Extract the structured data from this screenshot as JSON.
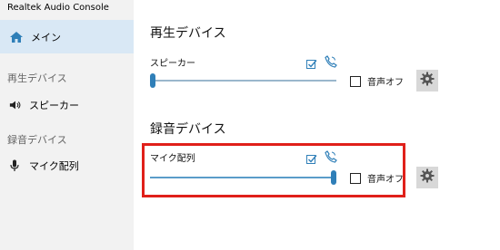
{
  "app": {
    "title": "Realtek Audio Console"
  },
  "sidebar": {
    "main_label": "メイン",
    "playback_section": "再生デバイス",
    "playback_item": "スピーカー",
    "recording_section": "録音デバイス",
    "recording_item": "マイク配列"
  },
  "main": {
    "playback": {
      "heading": "再生デバイス",
      "device_name": "スピーカー",
      "volume_percent": 0,
      "mute_label": "音声オフ",
      "muted": false
    },
    "recording": {
      "heading": "録音デバイス",
      "device_name": "マイク配列",
      "volume_percent": 100,
      "mute_label": "音声オフ",
      "muted": false
    }
  },
  "colors": {
    "accent": "#2f7fb8",
    "nav_selected": "#d9e8f5",
    "highlight": "#e0201a"
  },
  "icons": [
    "home-icon",
    "speaker-icon",
    "microphone-icon",
    "default-check-icon",
    "phone-icon",
    "gear-icon"
  ]
}
